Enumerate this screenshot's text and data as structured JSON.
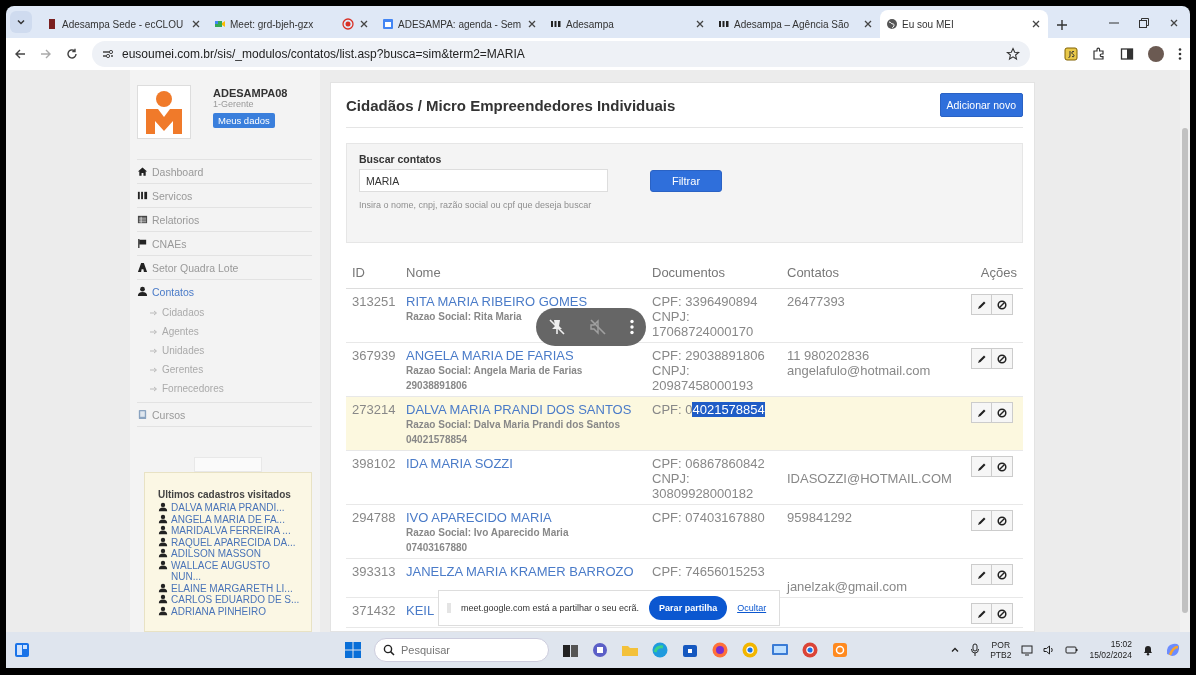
{
  "browser": {
    "tabs": [
      {
        "title": "Adesampa Sede - ecCLOU",
        "selected": false,
        "recording": false
      },
      {
        "title": "Meet: grd-bjeh-gzx",
        "selected": false,
        "recording": true
      },
      {
        "title": "ADESAMPA: agenda - Sem",
        "selected": false,
        "recording": false
      },
      {
        "title": "Adesampa",
        "selected": false,
        "recording": false
      },
      {
        "title": "Adesampa – Agência São",
        "selected": false,
        "recording": false
      },
      {
        "title": "Eu sou MEI",
        "selected": true,
        "recording": false
      }
    ],
    "address": "eusoumei.com.br/sis/_modulos/contatos/list.asp?busca=sim&term2=MARIA"
  },
  "sidebar": {
    "user": {
      "name": "ADESAMPA08",
      "role": "1-Gerente",
      "button": "Meus dados"
    },
    "nav": [
      {
        "label": "Dashboard",
        "selected": false
      },
      {
        "label": "Servicos",
        "selected": false
      },
      {
        "label": "Relatorios",
        "selected": false
      },
      {
        "label": "CNAEs",
        "selected": false
      },
      {
        "label": "Setor Quadra Lote",
        "selected": false
      },
      {
        "label": "Contatos",
        "selected": true,
        "children": [
          {
            "label": "Cidadaos"
          },
          {
            "label": "Agentes"
          },
          {
            "label": "Unidades"
          },
          {
            "label": "Gerentes"
          },
          {
            "label": "Fornecedores"
          }
        ]
      },
      {
        "label": "Cursos",
        "selected": false
      }
    ],
    "recent": {
      "title": "Ultimos cadastros visitados",
      "items": [
        "DALVA MARIA PRANDI...",
        "ANGELA MARIA DE FA...",
        "MARIDALVA FERREIRA ...",
        "RAQUEL APARECIDA DA...",
        "ADILSON MASSON",
        "WALLACE AUGUSTO NUN...",
        "ELAINE MARGARETH LI...",
        "CARLOS EDUARDO DE S...",
        "ADRIANA PINHEIRO"
      ]
    }
  },
  "main": {
    "title": "Cidadãos / Micro Empreendedores Individuais",
    "add_button": "Adicionar novo",
    "search": {
      "label": "Buscar contatos",
      "value": "MARIA",
      "button": "Filtrar",
      "help": "Insira o nome, cnpj, razão social ou cpf que deseja buscar"
    },
    "columns": [
      "ID",
      "Nome",
      "Documentos",
      "Contatos",
      "Ações"
    ],
    "rows": [
      {
        "id": "313251",
        "name": "RITA MARIA RIBEIRO GOMES",
        "details": [
          "Razao Social: Rita Maria"
        ],
        "documents": [
          "CPF: 3396490894",
          "CNPJ:",
          "17068724000170"
        ],
        "contacts": [
          {
            "kind": "phone",
            "text": "26477393"
          }
        ],
        "highlighted": false
      },
      {
        "id": "367939",
        "name": "ANGELA MARIA DE FARIAS",
        "details": [
          "Razao Social: Angela Maria de Farias",
          "29038891806"
        ],
        "documents": [
          "CPF: 29038891806",
          "CNPJ:",
          "20987458000193"
        ],
        "contacts": [
          {
            "kind": "phone",
            "text": "11 980202836"
          },
          {
            "kind": "email",
            "text": "angelafulo@hotmail.com"
          }
        ],
        "highlighted": false
      },
      {
        "id": "273214",
        "name": "DALVA MARIA PRANDI DOS SANTOS",
        "details": [
          "Razao Social: Dalva Maria Prandi dos Santos",
          "04021578854"
        ],
        "documents": [
          "CPF: 0"
        ],
        "selection": "4021578854",
        "contacts": [],
        "highlighted": true
      },
      {
        "id": "398102",
        "name": "IDA MARIA SOZZI",
        "details": [],
        "documents": [
          "CPF: 06867860842",
          "CNPJ:",
          "30809928000182"
        ],
        "contacts": [
          {
            "kind": "email",
            "text": "IDASOZZI@HOTMAIL.COM"
          }
        ],
        "highlighted": false
      },
      {
        "id": "294788",
        "name": "IVO APARECIDO MARIA",
        "details": [
          "Razao Social: Ivo Aparecido Maria",
          "07403167880"
        ],
        "documents": [
          "CPF: 07403167880"
        ],
        "contacts": [
          {
            "kind": "phone",
            "text": "959841292"
          }
        ],
        "highlighted": false
      },
      {
        "id": "393313",
        "name": "JANELZA MARIA KRAMER BARROZO",
        "details": [],
        "documents": [
          "CPF: 74656015253"
        ],
        "contacts": [
          {
            "kind": "email",
            "text": "janelzak@gmail.com"
          }
        ],
        "highlighted": false
      },
      {
        "id": "371432",
        "name": "KEIL",
        "details": [],
        "documents": [],
        "contacts": [],
        "highlighted": false
      }
    ]
  },
  "share_bar": {
    "message": "meet.google.com está a partilhar o seu ecrã.",
    "stop_button": "Parar partilha",
    "hide_link": "Ocultar"
  },
  "taskbar": {
    "search_placeholder": "Pesquisar",
    "language": "POR",
    "layout": "PTB2",
    "time": "15:02",
    "date": "15/02/2024"
  }
}
